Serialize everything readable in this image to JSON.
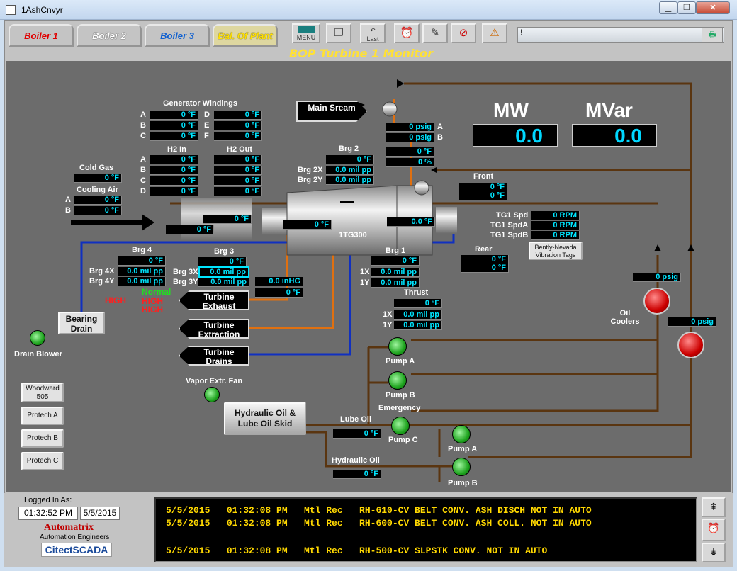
{
  "window": {
    "title": "1AshCnvyr",
    "min": "▁",
    "max": "❐",
    "close": "✕"
  },
  "tabs": [
    {
      "label": "Boiler 1",
      "color": "#e00000"
    },
    {
      "label": "Boiler 2",
      "color": "#ffffff"
    },
    {
      "label": "Boiler 3",
      "color": "#1060d0"
    },
    {
      "label": "Bal. Of Plant",
      "color": "#ffe000"
    }
  ],
  "toolbar": {
    "menu": "MENU",
    "last": "Last",
    "alarm_excl": "!"
  },
  "page_title": "BOP Turbine 1 Monitor",
  "generator_windings": {
    "title": "Generator Windings",
    "rows": [
      {
        "l1": "A",
        "v1": "0 °F",
        "l2": "D",
        "v2": "0 °F"
      },
      {
        "l1": "B",
        "v1": "0 °F",
        "l2": "E",
        "v2": "0 °F"
      },
      {
        "l1": "C",
        "v1": "0 °F",
        "l2": "F",
        "v2": "0 °F"
      }
    ]
  },
  "h2": {
    "in_title": "H2 In",
    "out_title": "H2 Out",
    "rows": [
      {
        "l": "A",
        "in": "0 °F",
        "out": "0 °F"
      },
      {
        "l": "B",
        "in": "0 °F",
        "out": "0 °F"
      },
      {
        "l": "C",
        "in": "0 °F",
        "out": "0 °F"
      },
      {
        "l": "D",
        "in": "0 °F",
        "out": "0 °F"
      }
    ]
  },
  "cold_gas": {
    "label": "Cold Gas",
    "value": "0 °F"
  },
  "cooling_air": {
    "label": "Cooling Air",
    "a_label": "A",
    "a": "0 °F",
    "b_label": "B",
    "b": "0 °F"
  },
  "main_steam": {
    "label": "Main Sream",
    "pa_label": "A",
    "pa": "0 psig",
    "pb_label": "B",
    "pb": "0 psig",
    "temp": "0 °F",
    "valve": "0 %"
  },
  "mw": {
    "label": "MW",
    "value": "0.0"
  },
  "mvar": {
    "label": "MVar",
    "value": "0.0"
  },
  "brg2": {
    "label": "Brg 2",
    "temp": "0 °F",
    "x_label": "Brg 2X",
    "x": "0.0 mil pp",
    "y_label": "Brg 2Y",
    "y": "0.0 mil pp"
  },
  "front": {
    "label": "Front",
    "v1": "0 °F",
    "v2": "0 °F"
  },
  "gen_temps": {
    "t1": "0 °F",
    "t2": "0 °F",
    "t3": "0 °F"
  },
  "turbine_temp": "0.0 °F",
  "turbine_name": "1TG300",
  "tg1": {
    "spd_label": "TG1 Spd",
    "spd": "0 RPM",
    "spda_label": "TG1 SpdA",
    "spda": "0 RPM",
    "spdb_label": "TG1 SpdB",
    "spdb": "0 RPM",
    "bently": "Bently-Nevada Vibration Tags"
  },
  "rear": {
    "label": "Rear",
    "v1": "0 °F",
    "v2": "0 °F"
  },
  "brg4": {
    "label": "Brg 4",
    "temp": "0 °F",
    "x_label": "Brg 4X",
    "x": "0.0 mil pp",
    "y_label": "Brg 4Y",
    "y": "0.0 mil pp"
  },
  "brg3": {
    "label": "Brg 3",
    "temp": "0 °F",
    "x_label": "Brg 3X",
    "x": "0.0 mil pp",
    "y_label": "Brg 3Y",
    "y": "0.0 mil pp"
  },
  "brg1": {
    "label": "Brg 1",
    "temp": "0 °F",
    "x_label": "1X",
    "x": "0.0 mil pp",
    "y_label": "1Y",
    "y": "0.0 mil pp"
  },
  "thrust": {
    "label": "Thrust",
    "temp": "0 °F",
    "x_label": "1X",
    "x": "0.0 mil pp",
    "y_label": "1Y",
    "y": "0.0 mil pp"
  },
  "status": {
    "high1": "HIGH",
    "normal": "Normal",
    "high2": "HIGH",
    "high3": "HIGH"
  },
  "exhaust": {
    "label": "Turbine Exhaust",
    "vacuum": "0.0 inHG",
    "temp": "0 °F"
  },
  "extraction": {
    "label": "Turbine Extraction"
  },
  "drains": {
    "label": "Turbine Drains"
  },
  "bearing_drain": {
    "label": "Bearing Drain",
    "blower": "Drain Blower"
  },
  "vapor_fan": "Vapor Extr. Fan",
  "skid": "Hydraulic Oil & Lube Oil Skid",
  "lube_oil": {
    "label": "Lube Oil",
    "value": "0 °F"
  },
  "hydraulic_oil": {
    "label": "Hydraulic Oil",
    "value": "0 °F"
  },
  "oil_coolers": {
    "label": "Oil Coolers",
    "p1": "0 psig",
    "p2": "0 psig"
  },
  "pumps": {
    "a": "Pump A",
    "b": "Pump B",
    "emergency": "Emergency",
    "c": "Pump C",
    "ha": "Pump A",
    "hb": "Pump B"
  },
  "side_buttons": [
    "Woodward 505",
    "Protech A",
    "Protech B",
    "Protech C"
  ],
  "login": {
    "label": "Logged In As:",
    "time": "01:32:52 PM",
    "date": "5/5/2015",
    "brand1": "Automatrix",
    "brand2": "Automation Engineers",
    "brand3": "CitectSCADA"
  },
  "alarms": [
    "5/5/2015   01:32:08 PM   Mtl Rec   RH-610-CV BELT CONV. ASH DISCH NOT IN AUTO",
    "5/5/2015   01:32:08 PM   Mtl Rec   RH-600-CV BELT CONV. ASH COLL. NOT IN AUTO",
    "",
    "5/5/2015   01:32:08 PM   Mtl Rec   RH-500-CV SLPSTK CONV. NOT IN AUTO"
  ],
  "colors": {
    "pipe_brown": "#5a3510",
    "pipe_blue": "#1030c0",
    "pipe_orange": "#e07010",
    "value_text": "#00e5ff",
    "alarm_text": "#ffd800"
  }
}
